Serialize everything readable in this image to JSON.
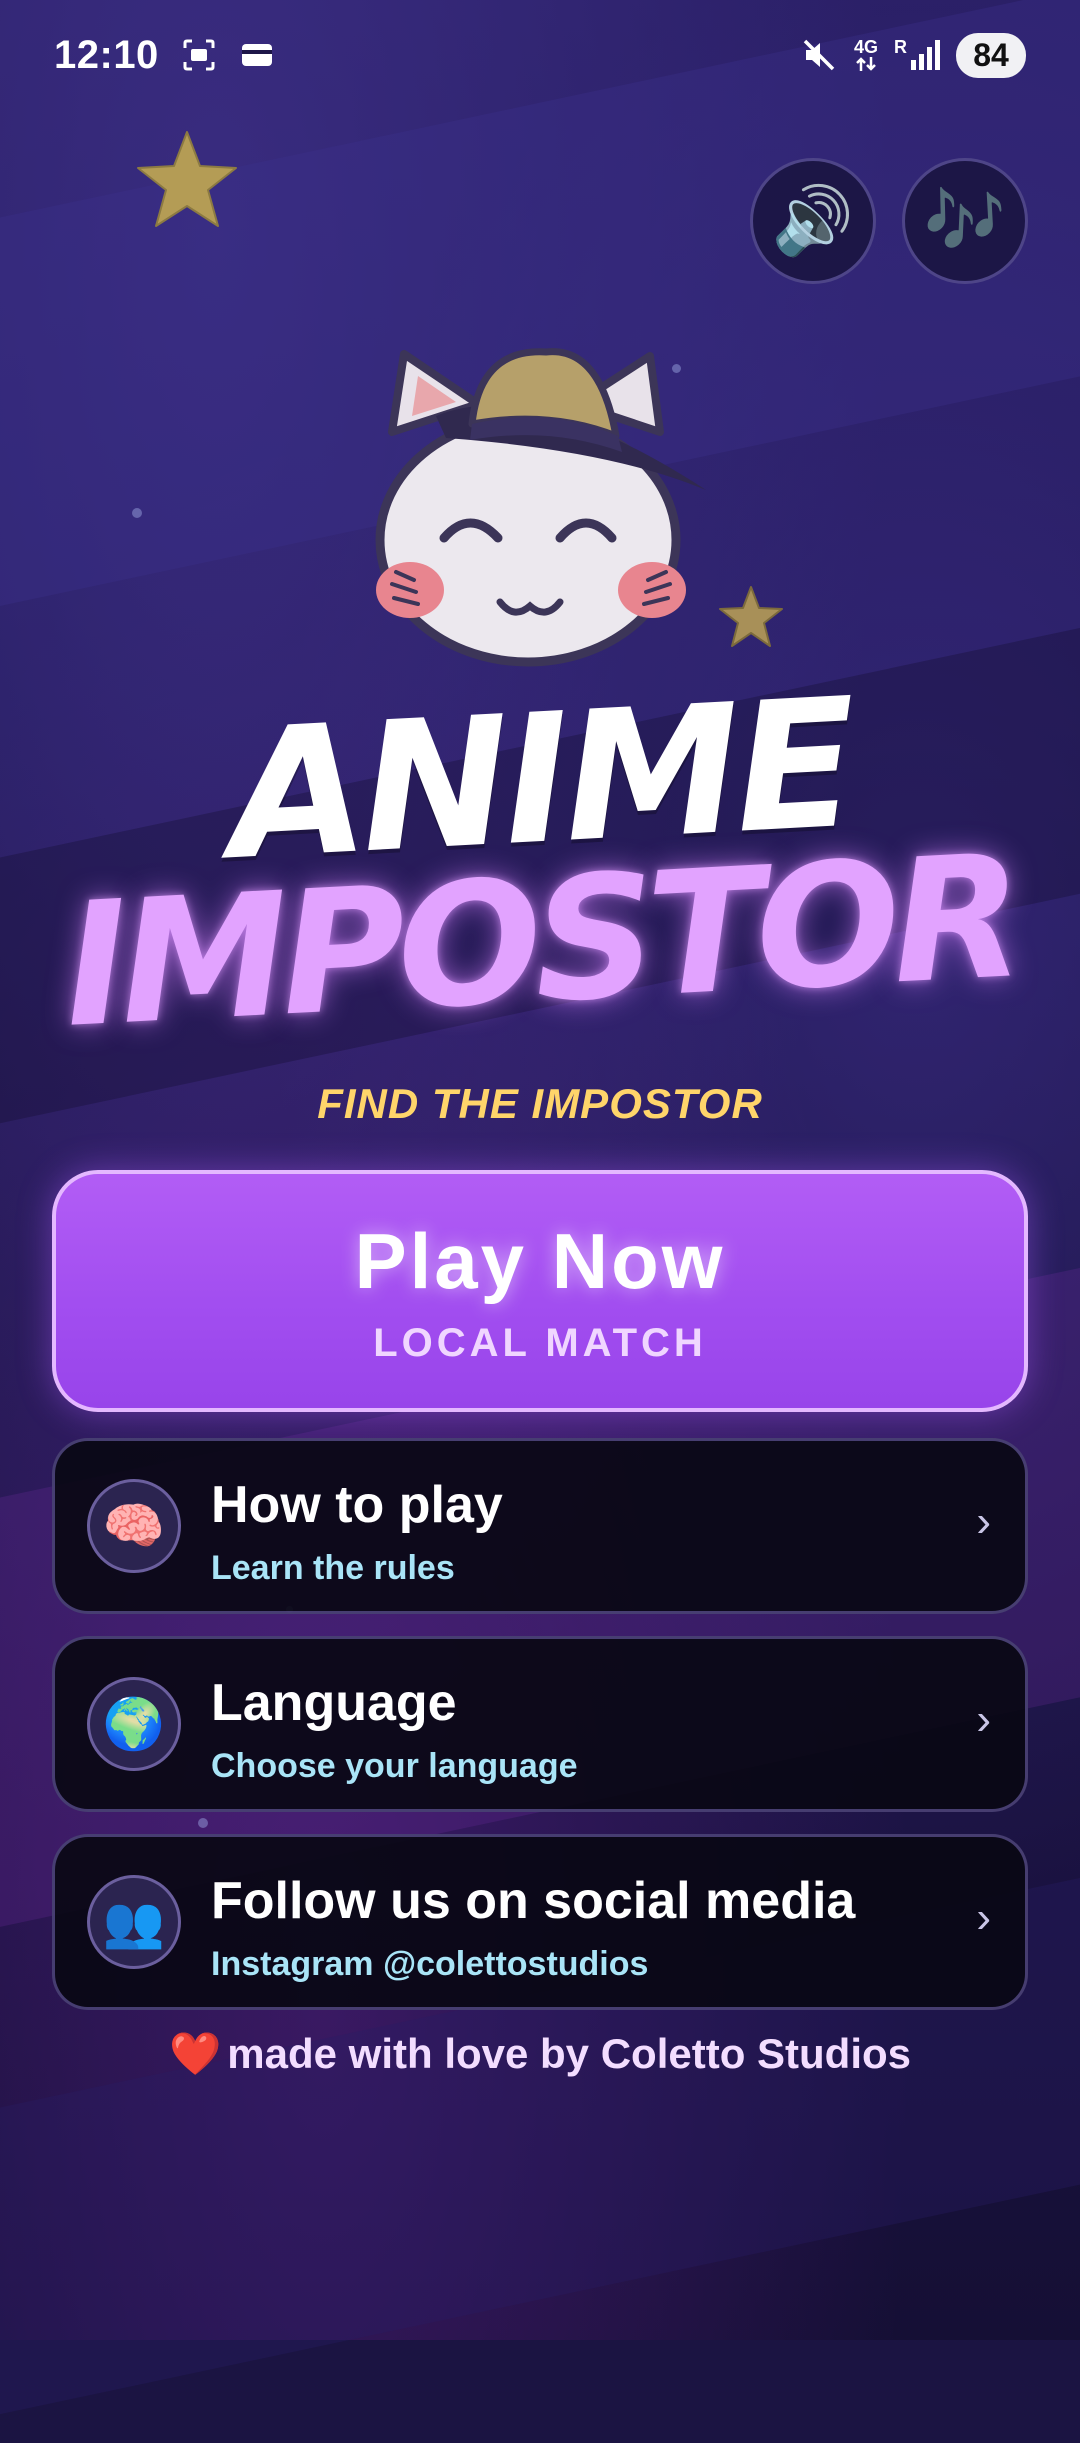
{
  "status_bar": {
    "time": "12:10",
    "network_top": "4G",
    "network_r": "R",
    "battery": "84"
  },
  "header": {
    "sound_icon": "🔊",
    "music_icon": "🎶"
  },
  "title": {
    "line1": "ANIME",
    "line2": "IMPOSTOR",
    "tagline": "FIND THE IMPOSTOR"
  },
  "play_button": {
    "label": "Play Now",
    "sublabel": "LOCAL MATCH"
  },
  "menu": [
    {
      "icon": "🧠",
      "title": "How to play",
      "subtitle": "Learn the rules",
      "chevron": "›"
    },
    {
      "icon": "🌍",
      "title": "Language",
      "subtitle": "Choose your language",
      "chevron": "›"
    },
    {
      "icon": "👥",
      "title": "Follow us on social media",
      "subtitle": "Instagram @colettostudios",
      "chevron": "›"
    }
  ],
  "footer": {
    "heart": "❤️",
    "text": "made with love by Coletto Studios"
  },
  "colors": {
    "accent_purple": "#a24ef0",
    "title_pink": "#e2a3ff",
    "tagline_yellow": "#ffd56a",
    "subtitle_cyan": "#a9e4f7",
    "background": "#1b1442"
  }
}
